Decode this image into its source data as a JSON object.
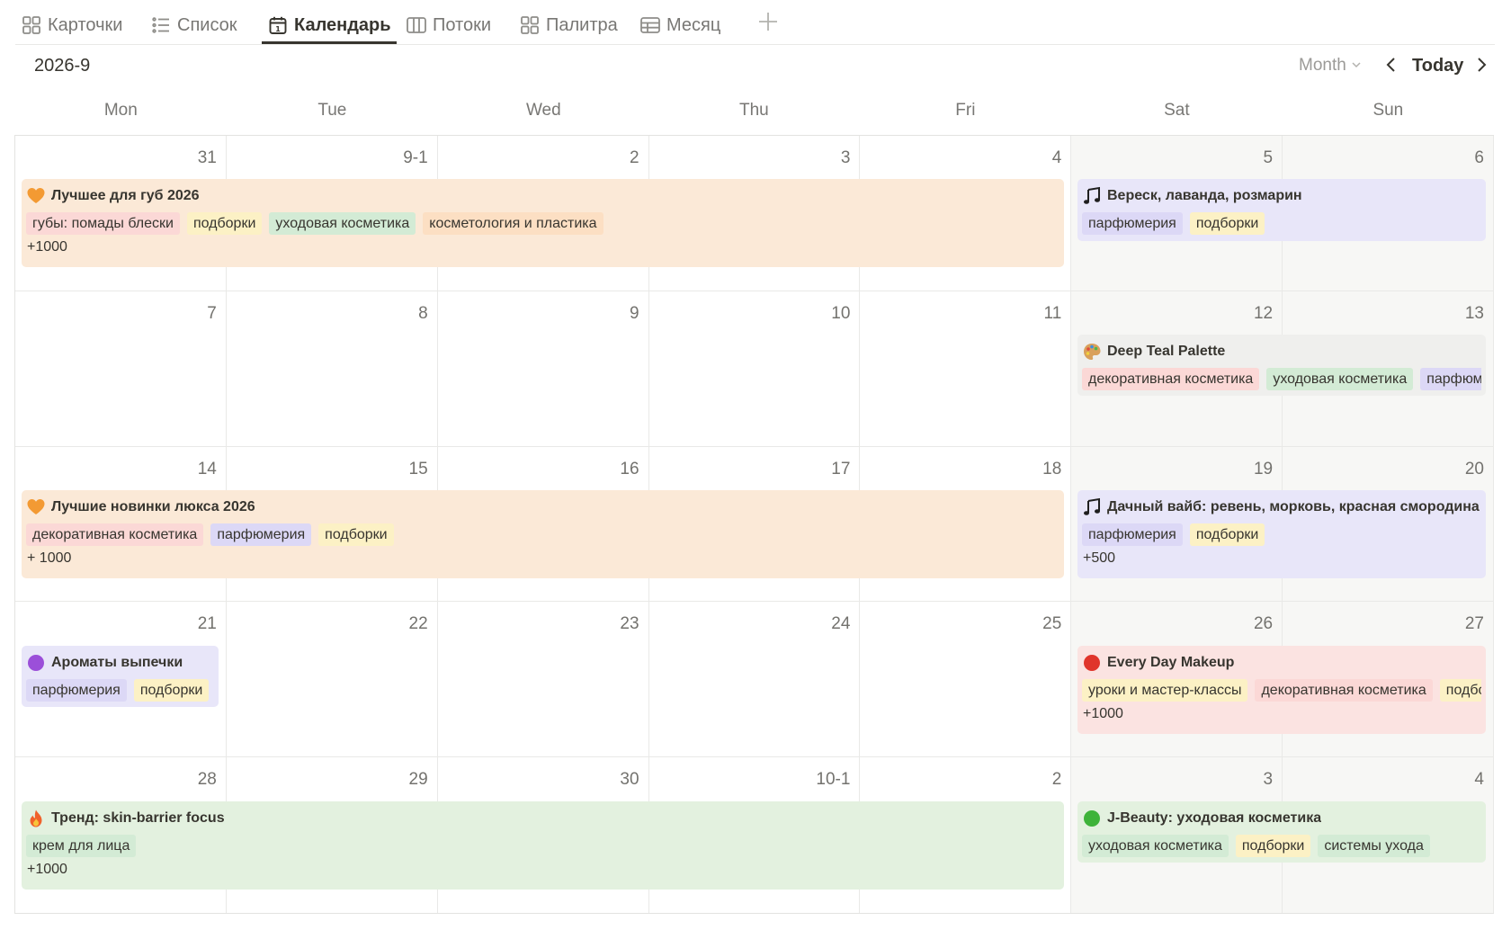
{
  "tabs": [
    {
      "label": "Карточки",
      "icon": "grid-icon"
    },
    {
      "label": "Список",
      "icon": "list-icon"
    },
    {
      "label": "Календарь",
      "icon": "calendar-icon"
    },
    {
      "label": "Потоки",
      "icon": "columns-icon"
    },
    {
      "label": "Палитра",
      "icon": "grid-icon"
    },
    {
      "label": "Месяц",
      "icon": "table-icon"
    }
  ],
  "active_tab": "Календарь",
  "header": {
    "period": "2026-9",
    "view_select": "Month",
    "today_label": "Today"
  },
  "weekdays": [
    "Mon",
    "Tue",
    "Wed",
    "Thu",
    "Fri",
    "Sat",
    "Sun"
  ],
  "weeks": [
    [
      "31",
      "9-1",
      "2",
      "3",
      "4",
      "5",
      "6"
    ],
    [
      "7",
      "8",
      "9",
      "10",
      "11",
      "12",
      "13"
    ],
    [
      "14",
      "15",
      "16",
      "17",
      "18",
      "19",
      "20"
    ],
    [
      "21",
      "22",
      "23",
      "24",
      "25",
      "26",
      "27"
    ],
    [
      "28",
      "29",
      "30",
      "10-1",
      "2",
      "3",
      "4"
    ]
  ],
  "colors": {
    "orange_bg": "#fbe9d7",
    "purple_bg": "#e8e6f9",
    "gray_bg": "#efefed",
    "red_bg": "#fbe3e1",
    "green_bg": "#e3f1df",
    "tag_red": "#fbd8d6",
    "tag_yellow": "#fcf1c5",
    "tag_green": "#d3ebd5",
    "tag_orange": "#fcdfc3",
    "tag_purple": "#dcd8f6",
    "tag_gray": "#e7e7e5"
  },
  "events": [
    {
      "emoji": "orange-heart",
      "title": "Лучшее для губ 2026",
      "bg": "orange",
      "tags": [
        [
          "губы: помады блески",
          "red"
        ],
        [
          "подборки",
          "yellow"
        ],
        [
          "уходовая косметика",
          "green"
        ],
        [
          "косметология и пластика",
          "orange"
        ]
      ],
      "more": "+1000"
    },
    {
      "emoji": "music-note",
      "title": "Вереск, лаванда, розмарин",
      "bg": "purple",
      "tags": [
        [
          "парфюмерия",
          "purple"
        ],
        [
          "подборки",
          "yellow"
        ]
      ],
      "more": ""
    },
    {
      "emoji": "palette",
      "title": "Deep Teal Palette",
      "bg": "gray",
      "tags": [
        [
          "декоративная косметика",
          "red"
        ],
        [
          "уходовая косметика",
          "green"
        ],
        [
          "парфюмерия",
          "purple"
        ]
      ],
      "more": ""
    },
    {
      "emoji": "orange-heart",
      "title": "Лучшие новинки люкса 2026",
      "bg": "orange",
      "tags": [
        [
          "декоративная косметика",
          "red"
        ],
        [
          "парфюмерия",
          "purple"
        ],
        [
          "подборки",
          "yellow"
        ]
      ],
      "more": "+ 1000"
    },
    {
      "emoji": "music-note",
      "title": "Дачный вайб: ревень, морковь, красная смородина",
      "bg": "purple",
      "tags": [
        [
          "парфюмерия",
          "purple"
        ],
        [
          "подборки",
          "yellow"
        ]
      ],
      "more": "+500"
    },
    {
      "emoji": "purple-circle",
      "title": "Ароматы выпечки",
      "bg": "purple",
      "tags": [
        [
          "парфюмерия",
          "purple"
        ],
        [
          "подборки",
          "yellow"
        ]
      ],
      "more": ""
    },
    {
      "emoji": "red-circle",
      "title": "Every Day Makeup",
      "bg": "red",
      "tags": [
        [
          "уроки и мастер-классы",
          "yellow"
        ],
        [
          "декоративная косметика",
          "red"
        ],
        [
          "подборки",
          "yellow"
        ]
      ],
      "more": "+1000"
    },
    {
      "emoji": "fire",
      "title": "Тренд: skin-barrier focus",
      "bg": "green",
      "tags": [
        [
          "крем для лица",
          "green"
        ]
      ],
      "more": "+1000"
    },
    {
      "emoji": "green-circle",
      "title": "J-Beauty: уходовая косметика",
      "bg": "green",
      "tags": [
        [
          "уходовая косметика",
          "green"
        ],
        [
          "подборки",
          "yellow"
        ],
        [
          "системы ухода",
          "green"
        ]
      ],
      "more": ""
    }
  ]
}
